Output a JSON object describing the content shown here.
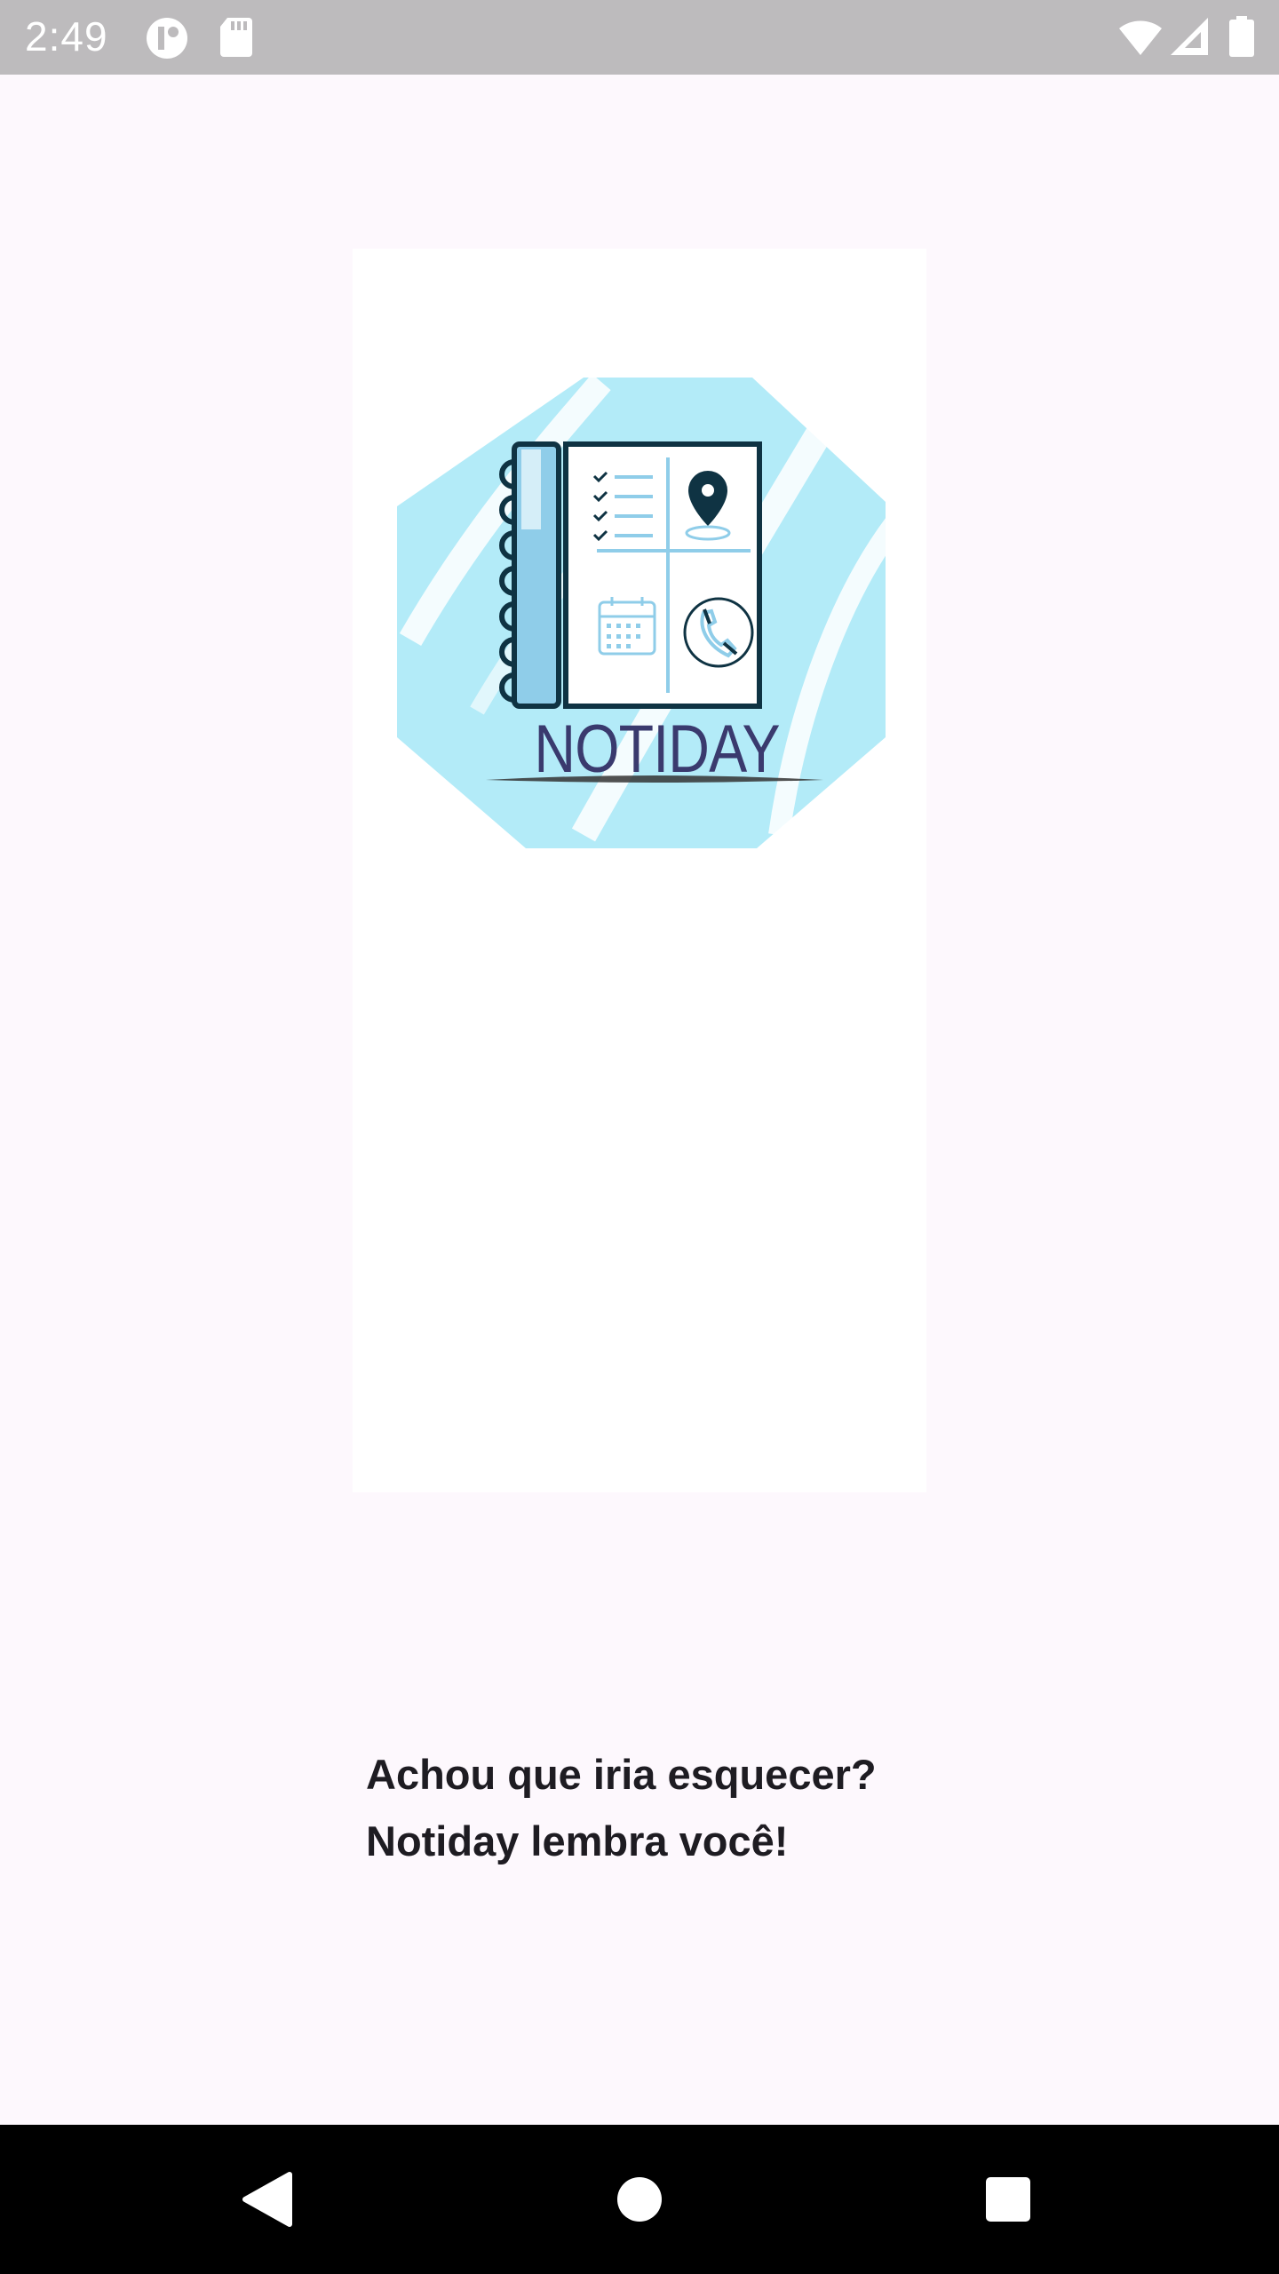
{
  "status_bar": {
    "time": "2:49",
    "icons": [
      "notification-app-icon",
      "sd-card-icon",
      "wifi-icon",
      "signal-icon",
      "battery-icon"
    ]
  },
  "splash": {
    "logo_text": "NOTIDAY",
    "logo_alt": "notebook-logo"
  },
  "tagline": {
    "line1": "Achou que iria esquecer?",
    "line2": "Notiday lembra você!"
  },
  "nav_bar": {
    "buttons": [
      "back-button",
      "home-button",
      "recents-button"
    ]
  },
  "colors": {
    "background": "#fdf8fd",
    "status_bar": "#bdbbbd",
    "logo_bg": "#b3ebf8",
    "logo_ink": "#0f3343",
    "logo_text": "#3a3a6e",
    "accent_light_blue": "#8fcde9"
  }
}
